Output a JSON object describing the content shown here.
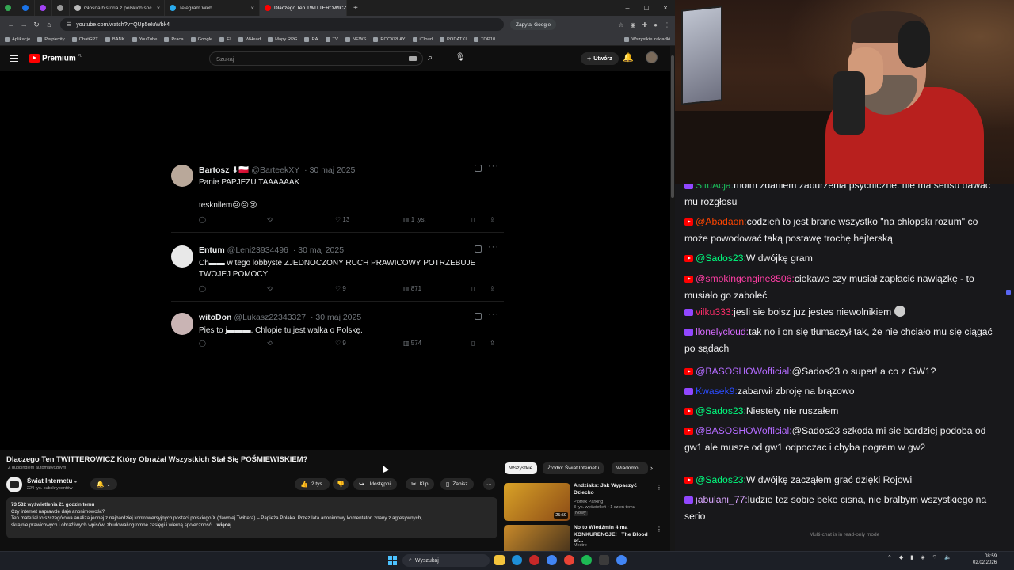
{
  "browser": {
    "tabs": [
      {
        "label": "",
        "active": false,
        "color": "#34a853"
      },
      {
        "label": "",
        "active": false,
        "color": "#1a73e8"
      },
      {
        "label": "",
        "active": false,
        "color": "#a142f4"
      },
      {
        "label": "",
        "active": false,
        "color": "#999999"
      },
      {
        "label": "Głośna historia z polskich soc",
        "active": false,
        "color": "#bbbbbb"
      },
      {
        "label": "Telegram Web",
        "active": false,
        "color": "#2aabee"
      },
      {
        "label": "Dlaczego Ten TWITTEROWICZ K",
        "active": true,
        "color": "#ff0000"
      }
    ],
    "url": "youtube.com/watch?v=QUp5eIuWbk4",
    "google_button": "Zapytaj Google",
    "bookmarks": [
      "Aplikacje",
      "Perplexity",
      "ChatGPT",
      "BANK",
      "YouTube",
      "Praca",
      "Google",
      "EI",
      "WHead",
      "Mapy RPG",
      "RA",
      "TV",
      "NEWS",
      "ROCKPLAY",
      "iCloud",
      "PODATKI",
      "TOP10"
    ],
    "bookmarks_right": "Wszystkie zakładki"
  },
  "youtube": {
    "logo_text": "Premium",
    "logo_sup": "PL",
    "search_placeholder": "Szukaj",
    "create_label": "Utwórz",
    "video_title": "Dlaczego Ten TWITTEROWICZ Który Obrażał Wszystkich Stał Się POŚMIEWISKIEM?",
    "dubbing": "Z dubbingiem automatycznym",
    "channel_name": "Świat Internetu",
    "channel_subs": "224 tys. subskrybentów",
    "likes": "2 tys.",
    "share": "Udostępnij",
    "clip": "Klip",
    "save": "Zapisz",
    "description": {
      "stats": "73 532 wyświetlenia  21 godzin temu",
      "line1": "Czy internet naprawdę daje anonimowość?",
      "line2": "Ten materiał to szczegółowa analiza jednej z najbardziej kontrowersyjnych postaci polskiego X (dawniej Twittera) – Papieża Polaka. Przez lata anonimowy komentator, znany z agresywnych,",
      "line3": "skrajnie prawicowych i obraźliwych wpisów, zbudował ogromne zasięgi i wierną społeczność",
      "more": "...więcej"
    },
    "chips": [
      "Wszystkie",
      "Źródło: Świat Internetu",
      "Wiadomo"
    ],
    "related": [
      {
        "title": "Andziaks: Jak Wypaczyć Dziecko",
        "channel": "Piotrek Parking",
        "meta": "3 tys. wyświetleń • 1 dzień temu",
        "badge": "Nowy",
        "duration": "25:59"
      },
      {
        "title": "No to Wiedźmin 4 ma KONKURENCJE! | The Blood of...",
        "channel": "Mestre",
        "meta": "",
        "badge": "",
        "duration": ""
      }
    ]
  },
  "tweets": [
    {
      "name": "Bartosz",
      "flag": "⬇🇵🇱",
      "handle": "@BarteekXY",
      "date": "30 maj 2025",
      "text1": "Panie PAPJEZU TAAAAAAK",
      "text2": "tesknilem😢😢😢",
      "likes": "13",
      "views": "1 tys."
    },
    {
      "name": "Entum",
      "handle": "@Leni23934496",
      "date": "30 maj 2025",
      "text1": "Ch▬▬ w tego lobbyste ZJEDNOCZONY RUCH PRAWICOWY POTRZEBUJE TWOJEJ POMOCY",
      "likes": "9",
      "views": "871"
    },
    {
      "name": "witoDon",
      "handle": "@Lukasz22343327",
      "date": "30 maj 2025",
      "text1": "Pies to j▬▬▬. Chlopie tu jest walka o Polskę.",
      "likes": "9",
      "views": "574"
    }
  ],
  "chat": {
    "messages": [
      {
        "platform": "tw",
        "user": "SituAcja:",
        "color": "#1db954",
        "text": "moim zdaniem zaburzenia psychiczne. nie ma sensu dawac mu rozgłosu"
      },
      {
        "platform": "yt",
        "user": "@Abadaon:",
        "color": "#ff4500",
        "text": "codzień to jest brane wszystko \"na chłopski rozum\" co może powodować taką postawę trochę hejterską"
      },
      {
        "platform": "yt",
        "user": "@Sados23:",
        "color": "#00ff7f",
        "text": "W dwójkę gram"
      },
      {
        "platform": "yt",
        "user": "@smokingengine8506:",
        "color": "#ff3ea5",
        "text": "ciekawe czy musiał zapłacić nawiązkę - to musiało go zaboleć"
      },
      {
        "platform": "tw",
        "user": "vilku333:",
        "color": "#ff2d6a",
        "text": "jesli sie boisz juz jestes niewolnikiem"
      },
      {
        "platform": "tw",
        "user": "llonelycloud:",
        "color": "#d66bff",
        "text": "tak no i on się tłumaczył tak, że nie chciało mu się ciągać po sądach"
      },
      {
        "platform": "yt",
        "user": "@BASOSHOWofficial:",
        "color": "#b36bff",
        "text": "@Sados23 o super! a co z GW1?"
      },
      {
        "platform": "tw",
        "user": "Kwasek9:",
        "color": "#2b4cff",
        "text": "zabarwił zbroję na brązowo"
      },
      {
        "platform": "yt",
        "user": "@Sados23:",
        "color": "#00ff7f",
        "text": "Niestety nie ruszałem"
      },
      {
        "platform": "yt",
        "user": "@BASOSHOWofficial:",
        "color": "#b36bff",
        "text": "@Sados23 szkoda mi sie bardziej podoba od gw1 ale musze od gw1 odpoczac i chyba pogram w gw2"
      },
      {
        "platform": "yt",
        "user": "@Sados23:",
        "color": "#00ff7f",
        "text": "W dwójkę zacząłem grać dzięki Rojowi"
      },
      {
        "platform": "tw",
        "user": "jabulani_77:",
        "color": "#d9a6ff",
        "text": "ludzie tez sobie beke cisna, nie bralbym wszystkiego na serio"
      }
    ],
    "footer": "Multi-chat is in read-only mode"
  },
  "taskbar": {
    "search": "Wyszukaj",
    "time": "08:59",
    "date": "02.02.2026"
  }
}
